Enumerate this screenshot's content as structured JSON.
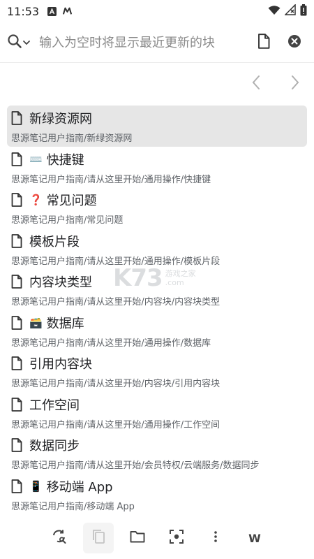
{
  "status_bar": {
    "time": "11:53"
  },
  "search": {
    "placeholder": "输入为空时将显示最近更新的块"
  },
  "results": [
    {
      "title": "新绿资源网",
      "emoji": "",
      "path": "思源笔记用户指南/新绿资源网",
      "active": true
    },
    {
      "title": "快捷键",
      "emoji": "⌨️",
      "path": "思源笔记用户指南/请从这里开始/通用操作/快捷键",
      "active": false
    },
    {
      "title": "常见问题",
      "emoji": "❓",
      "path": "思源笔记用户指南/常见问题",
      "active": false
    },
    {
      "title": "模板片段",
      "emoji": "",
      "path": "思源笔记用户指南/请从这里开始/通用操作/模板片段",
      "active": false
    },
    {
      "title": "内容块类型",
      "emoji": "",
      "path": "思源笔记用户指南/请从这里开始/内容块/内容块类型",
      "active": false
    },
    {
      "title": "数据库",
      "emoji": "🗃️",
      "path": "思源笔记用户指南/请从这里开始/通用操作/数据库",
      "active": false
    },
    {
      "title": "引用内容块",
      "emoji": "",
      "path": "思源笔记用户指南/请从这里开始/内容块/引用内容块",
      "active": false
    },
    {
      "title": "工作空间",
      "emoji": "",
      "path": "思源笔记用户指南/请从这里开始/通用操作/工作空间",
      "active": false
    },
    {
      "title": "数据同步",
      "emoji": "",
      "path": "思源笔记用户指南/请从这里开始/会员特权/云端服务/数据同步",
      "active": false
    },
    {
      "title": "移动端 App",
      "emoji": "📱",
      "path": "思源笔记用户指南/移动端 App",
      "active": false
    }
  ],
  "toolbar": {
    "w_label": "W"
  },
  "watermark": {
    "main": "K73",
    "sub1": "游戏之家",
    "sub2": ".com"
  },
  "colors": {
    "icon": "#555555",
    "active_bg": "#e6e6e6"
  }
}
